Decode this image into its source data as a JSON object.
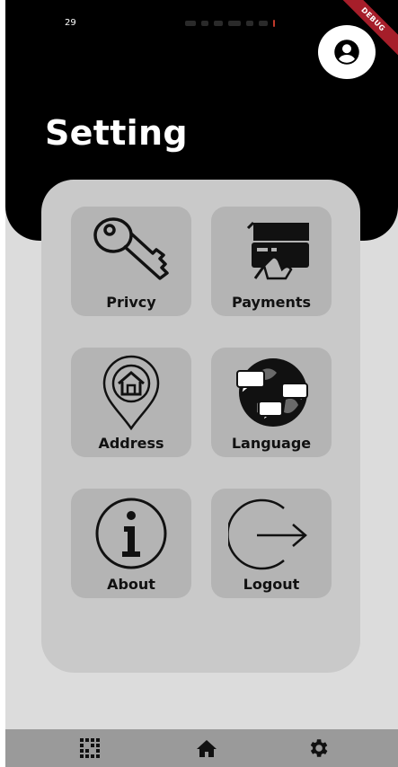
{
  "status_bar": {
    "time": "29"
  },
  "debug_banner": {
    "label": "DEBUG"
  },
  "header": {
    "title": "Setting",
    "avatar_icon": "account-circle-icon"
  },
  "settings_tiles": [
    {
      "label": "Privcy",
      "icon": "key-icon"
    },
    {
      "label": "Payments",
      "icon": "credit-card-payment-icon"
    },
    {
      "label": "Address",
      "icon": "home-location-pin-icon"
    },
    {
      "label": "Language",
      "icon": "globe-chat-icon"
    },
    {
      "label": "About",
      "icon": "info-circle-icon"
    },
    {
      "label": "Logout",
      "icon": "logout-arrow-icon"
    }
  ],
  "bottom_nav": [
    {
      "icon": "grid-icon"
    },
    {
      "icon": "home-icon"
    },
    {
      "icon": "settings-gear-icon"
    }
  ],
  "colors": {
    "header_bg": "#000000",
    "screen_bg": "#dcdcdc",
    "card_bg": "#c9c9c9",
    "tile_bg": "#b4b4b4",
    "bottom_nav_bg": "#9a9a9a",
    "debug_ribbon": "#a61e2a"
  }
}
